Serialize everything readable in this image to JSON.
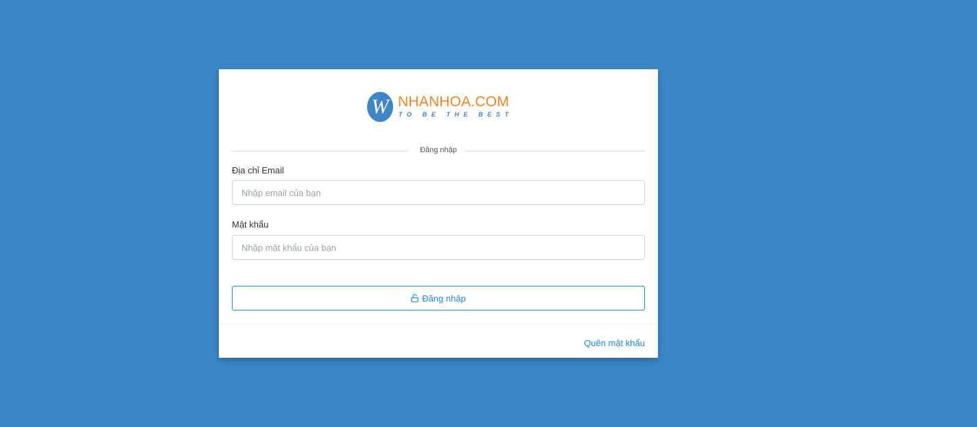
{
  "brand": {
    "logo_letter": "W",
    "name": "NHANHOA.COM",
    "tagline": "TO BE THE BEST"
  },
  "form": {
    "section_title": "Đăng nhập",
    "email_label": "Địa chỉ Email",
    "email_placeholder": "Nhập email của bạn",
    "email_value": "",
    "password_label": "Mật khẩu",
    "password_placeholder": "Nhập mật khẩu của bạn",
    "password_value": "",
    "submit_label": "Đăng nhập",
    "submit_icon": "unlock-icon"
  },
  "footer": {
    "forgot_password_label": "Quên mật khẩu"
  },
  "colors": {
    "background": "#3b87c8",
    "brand_orange": "#f58220",
    "brand_blue": "#3e86c6",
    "accent": "#1e88e5"
  }
}
